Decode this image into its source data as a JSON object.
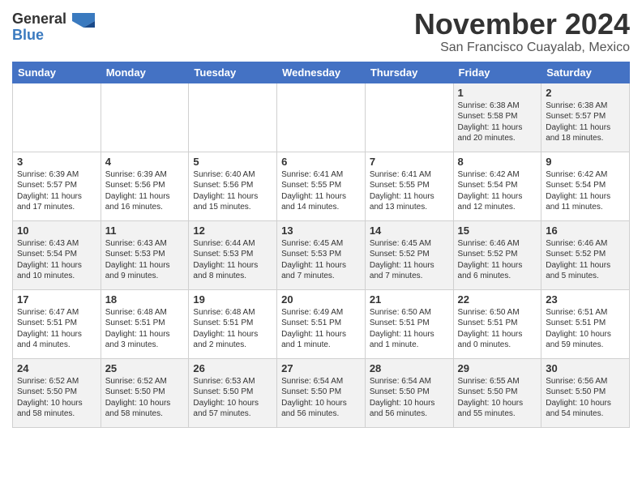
{
  "header": {
    "logo_general": "General",
    "logo_blue": "Blue",
    "month_title": "November 2024",
    "location": "San Francisco Cuayalab, Mexico"
  },
  "weekdays": [
    "Sunday",
    "Monday",
    "Tuesday",
    "Wednesday",
    "Thursday",
    "Friday",
    "Saturday"
  ],
  "weeks": [
    [
      {
        "day": "",
        "info": ""
      },
      {
        "day": "",
        "info": ""
      },
      {
        "day": "",
        "info": ""
      },
      {
        "day": "",
        "info": ""
      },
      {
        "day": "",
        "info": ""
      },
      {
        "day": "1",
        "info": "Sunrise: 6:38 AM\nSunset: 5:58 PM\nDaylight: 11 hours\nand 20 minutes."
      },
      {
        "day": "2",
        "info": "Sunrise: 6:38 AM\nSunset: 5:57 PM\nDaylight: 11 hours\nand 18 minutes."
      }
    ],
    [
      {
        "day": "3",
        "info": "Sunrise: 6:39 AM\nSunset: 5:57 PM\nDaylight: 11 hours\nand 17 minutes."
      },
      {
        "day": "4",
        "info": "Sunrise: 6:39 AM\nSunset: 5:56 PM\nDaylight: 11 hours\nand 16 minutes."
      },
      {
        "day": "5",
        "info": "Sunrise: 6:40 AM\nSunset: 5:56 PM\nDaylight: 11 hours\nand 15 minutes."
      },
      {
        "day": "6",
        "info": "Sunrise: 6:41 AM\nSunset: 5:55 PM\nDaylight: 11 hours\nand 14 minutes."
      },
      {
        "day": "7",
        "info": "Sunrise: 6:41 AM\nSunset: 5:55 PM\nDaylight: 11 hours\nand 13 minutes."
      },
      {
        "day": "8",
        "info": "Sunrise: 6:42 AM\nSunset: 5:54 PM\nDaylight: 11 hours\nand 12 minutes."
      },
      {
        "day": "9",
        "info": "Sunrise: 6:42 AM\nSunset: 5:54 PM\nDaylight: 11 hours\nand 11 minutes."
      }
    ],
    [
      {
        "day": "10",
        "info": "Sunrise: 6:43 AM\nSunset: 5:54 PM\nDaylight: 11 hours\nand 10 minutes."
      },
      {
        "day": "11",
        "info": "Sunrise: 6:43 AM\nSunset: 5:53 PM\nDaylight: 11 hours\nand 9 minutes."
      },
      {
        "day": "12",
        "info": "Sunrise: 6:44 AM\nSunset: 5:53 PM\nDaylight: 11 hours\nand 8 minutes."
      },
      {
        "day": "13",
        "info": "Sunrise: 6:45 AM\nSunset: 5:53 PM\nDaylight: 11 hours\nand 7 minutes."
      },
      {
        "day": "14",
        "info": "Sunrise: 6:45 AM\nSunset: 5:52 PM\nDaylight: 11 hours\nand 7 minutes."
      },
      {
        "day": "15",
        "info": "Sunrise: 6:46 AM\nSunset: 5:52 PM\nDaylight: 11 hours\nand 6 minutes."
      },
      {
        "day": "16",
        "info": "Sunrise: 6:46 AM\nSunset: 5:52 PM\nDaylight: 11 hours\nand 5 minutes."
      }
    ],
    [
      {
        "day": "17",
        "info": "Sunrise: 6:47 AM\nSunset: 5:51 PM\nDaylight: 11 hours\nand 4 minutes."
      },
      {
        "day": "18",
        "info": "Sunrise: 6:48 AM\nSunset: 5:51 PM\nDaylight: 11 hours\nand 3 minutes."
      },
      {
        "day": "19",
        "info": "Sunrise: 6:48 AM\nSunset: 5:51 PM\nDaylight: 11 hours\nand 2 minutes."
      },
      {
        "day": "20",
        "info": "Sunrise: 6:49 AM\nSunset: 5:51 PM\nDaylight: 11 hours\nand 1 minute."
      },
      {
        "day": "21",
        "info": "Sunrise: 6:50 AM\nSunset: 5:51 PM\nDaylight: 11 hours\nand 1 minute."
      },
      {
        "day": "22",
        "info": "Sunrise: 6:50 AM\nSunset: 5:51 PM\nDaylight: 11 hours\nand 0 minutes."
      },
      {
        "day": "23",
        "info": "Sunrise: 6:51 AM\nSunset: 5:51 PM\nDaylight: 10 hours\nand 59 minutes."
      }
    ],
    [
      {
        "day": "24",
        "info": "Sunrise: 6:52 AM\nSunset: 5:50 PM\nDaylight: 10 hours\nand 58 minutes."
      },
      {
        "day": "25",
        "info": "Sunrise: 6:52 AM\nSunset: 5:50 PM\nDaylight: 10 hours\nand 58 minutes."
      },
      {
        "day": "26",
        "info": "Sunrise: 6:53 AM\nSunset: 5:50 PM\nDaylight: 10 hours\nand 57 minutes."
      },
      {
        "day": "27",
        "info": "Sunrise: 6:54 AM\nSunset: 5:50 PM\nDaylight: 10 hours\nand 56 minutes."
      },
      {
        "day": "28",
        "info": "Sunrise: 6:54 AM\nSunset: 5:50 PM\nDaylight: 10 hours\nand 56 minutes."
      },
      {
        "day": "29",
        "info": "Sunrise: 6:55 AM\nSunset: 5:50 PM\nDaylight: 10 hours\nand 55 minutes."
      },
      {
        "day": "30",
        "info": "Sunrise: 6:56 AM\nSunset: 5:50 PM\nDaylight: 10 hours\nand 54 minutes."
      }
    ]
  ]
}
